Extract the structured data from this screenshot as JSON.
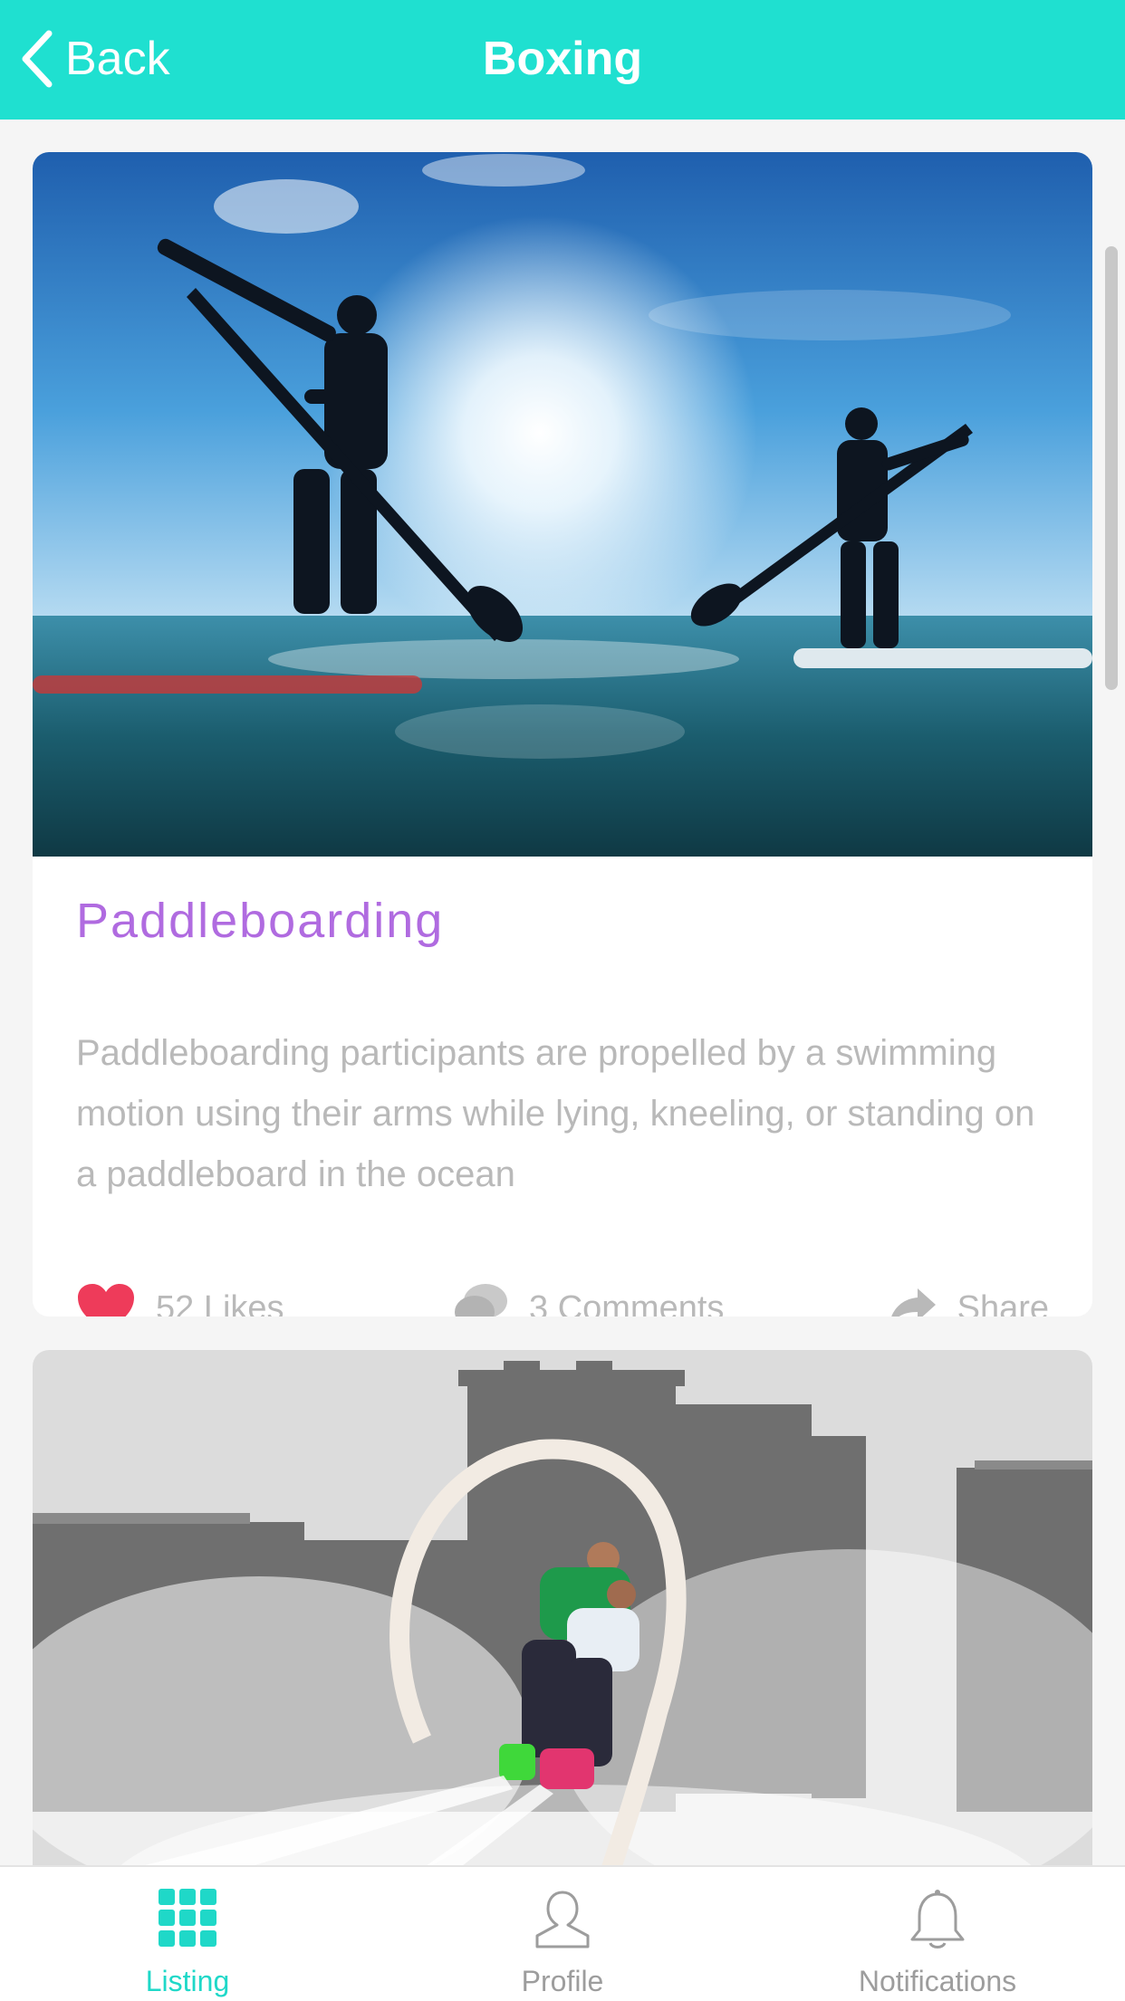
{
  "header": {
    "back_label": "Back",
    "title": "Boxing"
  },
  "posts": [
    {
      "title": "Paddleboarding",
      "description": "Paddleboarding participants are propelled by a swimming motion using their arms while lying, kneeling, or standing on a paddleboard in the ocean",
      "likes_label": "52 Likes",
      "comments_label": "3 Comments",
      "share_label": "Share",
      "image_icon": "paddleboarding-photo"
    },
    {
      "image_icon": "flyboarding-photo"
    }
  ],
  "tabbar": {
    "items": [
      {
        "label": "Listing",
        "icon": "grid-icon",
        "active": true
      },
      {
        "label": "Profile",
        "icon": "person-icon",
        "active": false
      },
      {
        "label": "Notifications",
        "icon": "bell-icon",
        "active": false
      }
    ]
  },
  "colors": {
    "accent": "#1fe0d0",
    "title": "#b06be0",
    "heart": "#ee3b5a",
    "muted_text": "#b9b9b9"
  }
}
